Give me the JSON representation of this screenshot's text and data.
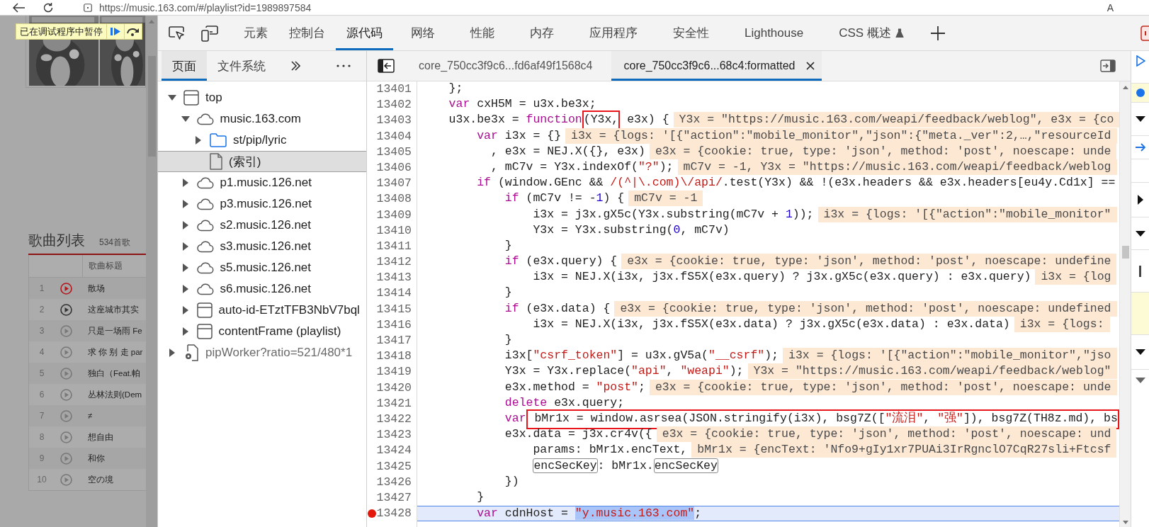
{
  "browser": {
    "url": "https://music.163.com/#/playlist?id=1989897584",
    "toolbar_label": "A"
  },
  "page": {
    "paused_banner": "已在调试程序中暂停",
    "playlist": {
      "title": "歌曲列表",
      "count": "534首歌",
      "column_title": "歌曲标题",
      "songs": [
        {
          "number": "1",
          "title": "散场",
          "kind": "playing"
        },
        {
          "number": "2",
          "title": "这座城市其实",
          "kind": "highlighted"
        },
        {
          "number": "3",
          "title": "只是一场雨 Fe",
          "kind": "normal"
        },
        {
          "number": "4",
          "title": "求 你 别 走 par",
          "kind": "normal"
        },
        {
          "number": "5",
          "title": "独白（Feat.帕",
          "kind": "normal"
        },
        {
          "number": "6",
          "title": "丛林法则(Dem",
          "kind": "normal"
        },
        {
          "number": "7",
          "title": "≠",
          "kind": "normal"
        },
        {
          "number": "8",
          "title": "想自由",
          "kind": "normal"
        },
        {
          "number": "9",
          "title": "和你",
          "kind": "normal"
        },
        {
          "number": "10",
          "title": "空の境",
          "kind": "normal"
        }
      ]
    }
  },
  "devtools": {
    "tabs": [
      {
        "label": "元素",
        "selected": false,
        "experimental": false
      },
      {
        "label": "控制台",
        "selected": false,
        "experimental": false
      },
      {
        "label": "源代码",
        "selected": true,
        "experimental": false
      },
      {
        "label": "网络",
        "selected": false,
        "experimental": false
      },
      {
        "label": "性能",
        "selected": false,
        "experimental": false
      },
      {
        "label": "内存",
        "selected": false,
        "experimental": false
      },
      {
        "label": "应用程序",
        "selected": false,
        "experimental": false
      },
      {
        "label": "安全性",
        "selected": false,
        "experimental": false
      },
      {
        "label": "Lighthouse",
        "selected": false,
        "experimental": false
      },
      {
        "label": "CSS 概述",
        "selected": false,
        "experimental": true
      }
    ],
    "navigator": {
      "tabs": [
        {
          "label": "页面",
          "selected": true
        },
        {
          "label": "文件系统",
          "selected": false
        }
      ],
      "tree": [
        {
          "label": "top",
          "kind": "frame",
          "expanded": true,
          "selected": false,
          "children": [
            {
              "label": "music.163.com",
              "kind": "domain",
              "expanded": true,
              "selected": false,
              "children": [
                {
                  "label": "st/pip/lyric",
                  "kind": "folder",
                  "expanded": false,
                  "selected": false
                },
                {
                  "label": "(索引)",
                  "kind": "file",
                  "selected": true
                }
              ]
            },
            {
              "label": "p1.music.126.net",
              "kind": "domain",
              "expanded": false,
              "selected": false
            },
            {
              "label": "p3.music.126.net",
              "kind": "domain",
              "expanded": false,
              "selected": false
            },
            {
              "label": "s2.music.126.net",
              "kind": "domain",
              "expanded": false,
              "selected": false
            },
            {
              "label": "s3.music.126.net",
              "kind": "domain",
              "expanded": false,
              "selected": false
            },
            {
              "label": "s5.music.126.net",
              "kind": "domain",
              "expanded": false,
              "selected": false
            },
            {
              "label": "s6.music.126.net",
              "kind": "domain",
              "expanded": false,
              "selected": false
            },
            {
              "label": "auto-id-ETztTFB3NbV7bql",
              "kind": "frame",
              "expanded": false,
              "selected": false
            },
            {
              "label": "contentFrame (playlist)",
              "kind": "frame",
              "expanded": false,
              "selected": false
            }
          ]
        },
        {
          "label": "pipWorker?ratio=521/480*1",
          "kind": "worker",
          "expanded": false,
          "selected": false
        }
      ]
    },
    "editor": {
      "tabs": [
        {
          "label": "core_750cc3f9c6...fd6af49f1568c4",
          "selected": false
        },
        {
          "label": "core_750cc3f9c6...68c4:formatted",
          "selected": true
        }
      ],
      "lines": [
        {
          "number": "13401",
          "breakpoint": false,
          "current": false,
          "tokens": [
            {
              "kind": "plain",
              "text": "    };"
            }
          ]
        },
        {
          "number": "13402",
          "breakpoint": false,
          "current": false,
          "tokens": [
            {
              "kind": "keyword",
              "text": "    var"
            },
            {
              "kind": "plain",
              "text": " cxH5M = u3x.be3x;"
            }
          ]
        },
        {
          "number": "13403",
          "breakpoint": false,
          "current": false,
          "tokens": [
            {
              "kind": "plain",
              "text": "    u3x.be3x = "
            },
            {
              "kind": "keyword",
              "text": "function"
            },
            {
              "kind": "plain",
              "text": "(Y3x,",
              "boxed": true
            },
            {
              "kind": "plain",
              "text": " e3x) {"
            }
          ],
          "hint": "Y3x = \"https://music.163.com/weapi/feedback/weblog\", e3x = {co"
        },
        {
          "number": "13404",
          "breakpoint": false,
          "current": false,
          "tokens": [
            {
              "kind": "keyword",
              "text": "        var"
            },
            {
              "kind": "plain",
              "text": " i3x = {}"
            }
          ],
          "hint": "i3x = {logs: '[{\"action\":\"mobile_monitor\",\"json\":{\"meta._ver\":2,…,\"resourceId"
        },
        {
          "number": "13405",
          "breakpoint": false,
          "current": false,
          "tokens": [
            {
              "kind": "plain",
              "text": "          , e3x = NEJ.X({}, e3x)"
            }
          ],
          "hint": "e3x = {cookie: true, type: 'json', method: 'post', noescape: unde"
        },
        {
          "number": "13406",
          "breakpoint": false,
          "current": false,
          "tokens": [
            {
              "kind": "plain",
              "text": "          , mC7v = Y3x.indexOf("
            },
            {
              "kind": "string",
              "text": "\"?\""
            },
            {
              "kind": "plain",
              "text": ");"
            }
          ],
          "hint": "mC7v = -1, Y3x = \"https://music.163.com/weapi/feedback/weblog"
        },
        {
          "number": "13407",
          "breakpoint": false,
          "current": false,
          "tokens": [
            {
              "kind": "keyword",
              "text": "        if"
            },
            {
              "kind": "plain",
              "text": " (window.GEnc && "
            },
            {
              "kind": "regex",
              "text": "/(^|\\.com)\\/api/"
            },
            {
              "kind": "plain",
              "text": ".test(Y3x) && !(e3x.headers && e3x.headers[eu4y.Cd1x] =="
            }
          ]
        },
        {
          "number": "13408",
          "breakpoint": false,
          "current": false,
          "tokens": [
            {
              "kind": "keyword",
              "text": "            if"
            },
            {
              "kind": "plain",
              "text": " (mC7v != -"
            },
            {
              "kind": "number",
              "text": "1"
            },
            {
              "kind": "plain",
              "text": ") {"
            }
          ],
          "hint": "mC7v = -1"
        },
        {
          "number": "13409",
          "breakpoint": false,
          "current": false,
          "tokens": [
            {
              "kind": "plain",
              "text": "                i3x = j3x.gX5c(Y3x.substring(mC7v + "
            },
            {
              "kind": "number",
              "text": "1"
            },
            {
              "kind": "plain",
              "text": "));"
            }
          ],
          "hint": "i3x = {logs: '[{\"action\":\"mobile_monitor\""
        },
        {
          "number": "13410",
          "breakpoint": false,
          "current": false,
          "tokens": [
            {
              "kind": "plain",
              "text": "                Y3x = Y3x.substring("
            },
            {
              "kind": "number",
              "text": "0"
            },
            {
              "kind": "plain",
              "text": ", mC7v)"
            }
          ]
        },
        {
          "number": "13411",
          "breakpoint": false,
          "current": false,
          "tokens": [
            {
              "kind": "plain",
              "text": "            }"
            }
          ]
        },
        {
          "number": "13412",
          "breakpoint": false,
          "current": false,
          "tokens": [
            {
              "kind": "keyword",
              "text": "            if"
            },
            {
              "kind": "plain",
              "text": " (e3x.query) {"
            }
          ],
          "hint": "e3x = {cookie: true, type: 'json', method: 'post', noescape: undefine"
        },
        {
          "number": "13413",
          "breakpoint": false,
          "current": false,
          "tokens": [
            {
              "kind": "plain",
              "text": "                i3x = NEJ.X(i3x, j3x.fS5X(e3x.query) ? j3x.gX5c(e3x.query) : e3x.query)"
            }
          ],
          "hint": "i3x = {log"
        },
        {
          "number": "13414",
          "breakpoint": false,
          "current": false,
          "tokens": [
            {
              "kind": "plain",
              "text": "            }"
            }
          ]
        },
        {
          "number": "13415",
          "breakpoint": false,
          "current": false,
          "tokens": [
            {
              "kind": "keyword",
              "text": "            if"
            },
            {
              "kind": "plain",
              "text": " (e3x.data) {"
            }
          ],
          "hint": "e3x = {cookie: true, type: 'json', method: 'post', noescape: undefined"
        },
        {
          "number": "13416",
          "breakpoint": false,
          "current": false,
          "tokens": [
            {
              "kind": "plain",
              "text": "                i3x = NEJ.X(i3x, j3x.fS5X(e3x.data) ? j3x.gX5c(e3x.data) : e3x.data)"
            }
          ],
          "hint": "i3x = {logs:"
        },
        {
          "number": "13417",
          "breakpoint": false,
          "current": false,
          "tokens": [
            {
              "kind": "plain",
              "text": "            }"
            }
          ]
        },
        {
          "number": "13418",
          "breakpoint": false,
          "current": false,
          "tokens": [
            {
              "kind": "plain",
              "text": "            i3x["
            },
            {
              "kind": "string",
              "text": "\"csrf_token\""
            },
            {
              "kind": "plain",
              "text": "] = u3x.gV5a("
            },
            {
              "kind": "string",
              "text": "\"__csrf\""
            },
            {
              "kind": "plain",
              "text": ");"
            }
          ],
          "hint": "i3x = {logs: '[{\"action\":\"mobile_monitor\",\"jso"
        },
        {
          "number": "13419",
          "breakpoint": false,
          "current": false,
          "tokens": [
            {
              "kind": "plain",
              "text": "            Y3x = Y3x.replace("
            },
            {
              "kind": "string",
              "text": "\"api\""
            },
            {
              "kind": "plain",
              "text": ", "
            },
            {
              "kind": "string",
              "text": "\"weapi\""
            },
            {
              "kind": "plain",
              "text": ");"
            }
          ],
          "hint": "Y3x = \"https://music.163.com/weapi/feedback/weblog\""
        },
        {
          "number": "13420",
          "breakpoint": false,
          "current": false,
          "tokens": [
            {
              "kind": "plain",
              "text": "            e3x.method = "
            },
            {
              "kind": "string",
              "text": "\"post\""
            },
            {
              "kind": "plain",
              "text": ";"
            }
          ],
          "hint": "e3x = {cookie: true, type: 'json', method: 'post', noescape: unde"
        },
        {
          "number": "13421",
          "breakpoint": false,
          "current": false,
          "tokens": [
            {
              "kind": "keyword",
              "text": "            delete"
            },
            {
              "kind": "plain",
              "text": " e3x.query;"
            }
          ]
        },
        {
          "number": "13422",
          "breakpoint": false,
          "current": false,
          "tokens": [
            {
              "kind": "keyword",
              "text": "            var"
            },
            {
              "kind": "plain",
              "text": " bMr1x = window.asrsea(JSON.stringify(i3x), bsg7Z([",
              "boxed": true
            },
            {
              "kind": "string",
              "text": "\"流泪\"",
              "boxed": true
            },
            {
              "kind": "plain",
              "text": ", ",
              "boxed": true
            },
            {
              "kind": "string",
              "text": "\"强\"",
              "boxed": true
            },
            {
              "kind": "plain",
              "text": "]), bsg7Z(TH8z.md), bs",
              "boxed": true
            }
          ]
        },
        {
          "number": "13423",
          "breakpoint": false,
          "current": false,
          "tokens": [
            {
              "kind": "plain",
              "text": "            e3x.data = j3x.cr4v({"
            }
          ],
          "hint": "e3x = {cookie: true, type: 'json', method: 'post', noescape: und"
        },
        {
          "number": "13424",
          "breakpoint": false,
          "current": false,
          "tokens": [
            {
              "kind": "plain",
              "text": "                params: bMr1x.encText,"
            }
          ],
          "hint": "bMr1x = {encText: 'Nfo9+gIy1xr7PUAi3IrRgnclO7CqR27sli+Ftcsf"
        },
        {
          "number": "13425",
          "breakpoint": false,
          "current": false,
          "tokens": [
            {
              "kind": "plain",
              "text": "                encSecKey",
              "outlined": true
            },
            {
              "kind": "plain",
              "text": ": bMr1x."
            },
            {
              "kind": "plain",
              "text": "encSecKey",
              "outlined": true
            }
          ]
        },
        {
          "number": "13426",
          "breakpoint": false,
          "current": false,
          "tokens": [
            {
              "kind": "plain",
              "text": "            })"
            }
          ]
        },
        {
          "number": "13427",
          "breakpoint": false,
          "current": false,
          "tokens": [
            {
              "kind": "plain",
              "text": "        }"
            }
          ]
        },
        {
          "number": "13428",
          "breakpoint": true,
          "current": true,
          "tokens": [
            {
              "kind": "keyword",
              "text": "        var"
            },
            {
              "kind": "plain",
              "text": " cdnHost = "
            },
            {
              "kind": "string",
              "text": "\"y.music.163.com\"",
              "selected_text": true
            },
            {
              "kind": "plain",
              "text": ";"
            }
          ]
        }
      ]
    }
  }
}
